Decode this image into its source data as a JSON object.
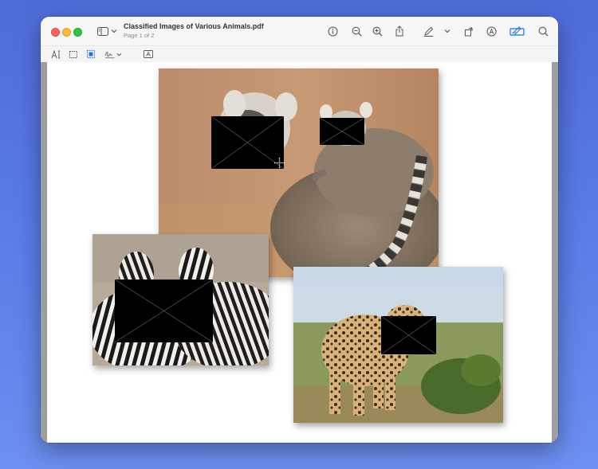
{
  "window": {
    "title": "Classified Images of Various Animals.pdf",
    "subtitle": "Page 1 of 2"
  },
  "toolbar": {
    "icons": [
      "sidebar-icon",
      "chevron-down-icon",
      "info-icon",
      "zoom-out-icon",
      "zoom-in-icon",
      "share-icon",
      "pen-icon",
      "chevron-down-icon",
      "rotate-icon",
      "markup-icon",
      "form-fill-icon",
      "search-icon"
    ],
    "accent": "#1a73e8"
  },
  "markup_toolbar": {
    "icons": [
      "text-select-icon",
      "rect-select-icon",
      "redact-tool-icon",
      "sign-icon",
      "text-box-icon"
    ]
  },
  "document": {
    "photos": [
      {
        "subject": "lemurs",
        "redactions": 2
      },
      {
        "subject": "zebras",
        "redactions": 1
      },
      {
        "subject": "leopard",
        "redactions": 1
      }
    ],
    "redaction_color": "#000000"
  }
}
